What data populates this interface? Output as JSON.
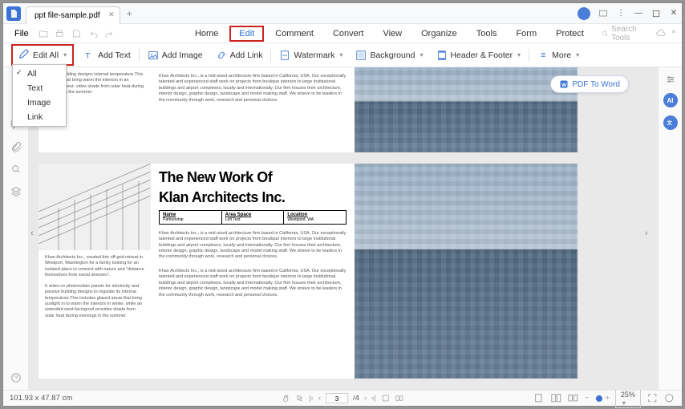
{
  "tab_title": "ppt file-sample.pdf",
  "menus": {
    "file": "File",
    "home": "Home",
    "edit": "Edit",
    "comment": "Comment",
    "convert": "Convert",
    "view": "View",
    "organize": "Organize",
    "tools": "Tools",
    "form": "Form",
    "protect": "Protect",
    "search": "Search Tools"
  },
  "toolbar": {
    "edit_all": "Edit All",
    "add_text": "Add Text",
    "add_image": "Add Image",
    "add_link": "Add Link",
    "watermark": "Watermark",
    "background": "Background",
    "header_footer": "Header & Footer",
    "more": "More"
  },
  "dropdown": {
    "all": "All",
    "text": "Text",
    "image": "Image",
    "link": "Link"
  },
  "pdf2word": "PDF To Word",
  "doc": {
    "heading1": "The New Work Of",
    "heading2": "Klan Architects Inc.",
    "table": {
      "c1": "Name",
      "c1v": "Partnership",
      "c2": "Area Space",
      "c2v": "Loft Test",
      "c3": "Location",
      "c3v": "Westpoint, WA"
    },
    "body": "Khan Architects Inc., is a mid-sized architecture firm based in California, USA. Our exceptionally talented and experienced staff work on projects from boutique interiors to large institutional buildings and airport complexes, locally and internationally. Our firm houses their architecture, interior design, graphic design, landscape and model making staff. We strieve to be leaders in the community through work, research and personal choices.",
    "side1": "passive building designs internal temperature.This ed areas that bring warm the interiors in an extended west- vides shade from solar heat during evenings in the summer.",
    "side2a": "Khan Architects Inc., created this off-grid retreat in Westport, Washington for a family looking for an isolated place to connect with nature and \"distance themselves from social stresses\".",
    "side2b": "It relies on photovoltaic panels for electricity and passive building designs to regulate its internal temperature.This includes glazed areas that bring sunlight in to warm the interiors in winter, while an extended west-facingroof provides shade from solar heat during evenings in the summer."
  },
  "status": {
    "coords": "101.93 x 47.87 cm",
    "page": "3",
    "total": "/4",
    "zoom": "25%"
  }
}
